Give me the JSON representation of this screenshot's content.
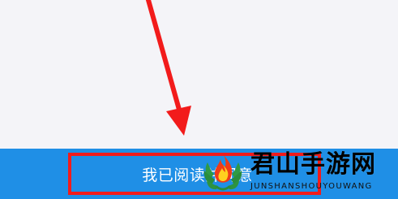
{
  "screen": {
    "background_color": "#f4f4f8",
    "bottom_bar_color": "#1f8fe6",
    "annotation_color": "#f21b1b"
  },
  "bottom_action": {
    "label": "我已阅读并同意"
  },
  "watermark": {
    "title": "君山手游网",
    "subtitle": "JUNSHANSHOUYOUWANG"
  },
  "icons": {
    "annotation_arrow": "red-arrow-icon",
    "watermark_logo": "flame-laurel-logo-icon"
  }
}
